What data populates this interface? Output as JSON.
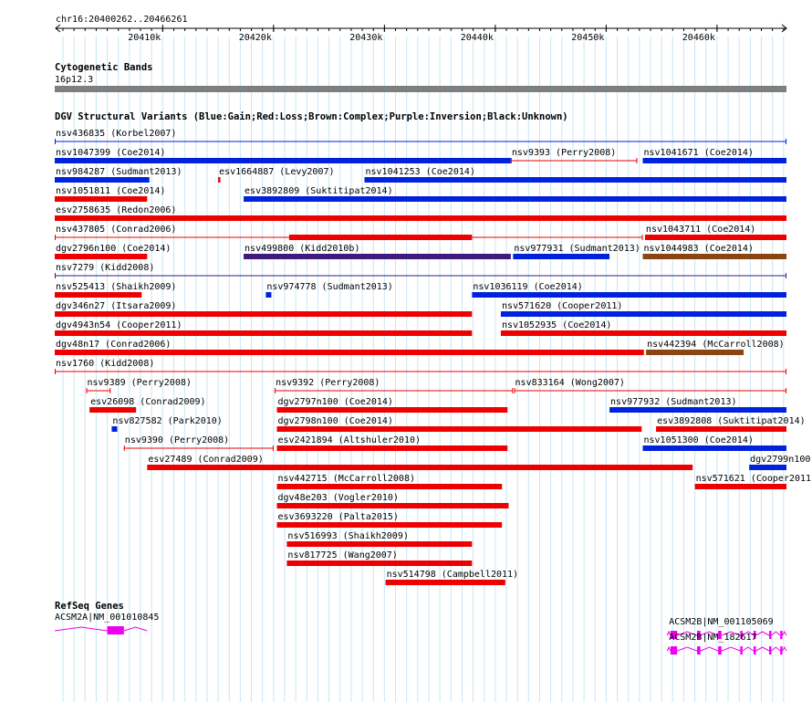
{
  "ruler": {
    "position_label": "chr16:20400262..20466261",
    "start": 20400262,
    "end": 20466261,
    "ticks": [
      {
        "pos": 20410000,
        "label": "20410k"
      },
      {
        "pos": 20420000,
        "label": "20420k"
      },
      {
        "pos": 20430000,
        "label": "20430k"
      },
      {
        "pos": 20440000,
        "label": "20440k"
      },
      {
        "pos": 20450000,
        "label": "20450k"
      },
      {
        "pos": 20460000,
        "label": "20460k"
      }
    ]
  },
  "cytoband": {
    "title": "Cytogenetic Bands",
    "band_label": "16p12.3",
    "color": "#7f7f7f"
  },
  "dgv": {
    "title": "DGV Structural Variants (Blue:Gain;Red:Loss;Brown:Complex;Purple:Inversion;Black:Unknown)",
    "colors": {
      "gain": "#0022dd",
      "loss": "#ee0000",
      "complex": "#8b4513",
      "inversion": "#3f1a7f",
      "unknown": "#000000"
    },
    "variants": [
      {
        "name": "nsv436835 (Korbel2007)",
        "start": 20400262,
        "end": 20466261,
        "type": "gain",
        "style": "line",
        "row": 0
      },
      {
        "name": "nsv1047399 (Coe2014)",
        "start": 20400262,
        "end": 20441400,
        "type": "gain",
        "style": "bar",
        "row": 1
      },
      {
        "name": "nsv9393 (Perry2008)",
        "start": 20441400,
        "end": 20452800,
        "type": "loss",
        "style": "line",
        "row": 1
      },
      {
        "name": "nsv1041671 (Coe2014)",
        "start": 20453300,
        "end": 20466261,
        "type": "gain",
        "style": "bar",
        "row": 1
      },
      {
        "name": "nsv984287 (Sudmant2013)",
        "start": 20400262,
        "end": 20408800,
        "type": "gain",
        "style": "bar",
        "row": 2
      },
      {
        "name": "esv1664887 (Levy2007)",
        "start": 20415000,
        "end": 20415200,
        "type": "loss",
        "style": "bar",
        "row": 2
      },
      {
        "name": "nsv1041253 (Coe2014)",
        "start": 20428200,
        "end": 20466261,
        "type": "gain",
        "style": "bar",
        "row": 2
      },
      {
        "name": "nsv1051811 (Coe2014)",
        "start": 20400262,
        "end": 20408600,
        "type": "loss",
        "style": "bar",
        "row": 3
      },
      {
        "name": "esv3892809 (Suktitipat2014)",
        "start": 20417300,
        "end": 20466261,
        "type": "gain",
        "style": "bar",
        "row": 3
      },
      {
        "name": "esv2758635 (Redon2006)",
        "start": 20400262,
        "end": 20466261,
        "type": "loss",
        "style": "bar",
        "row": 4
      },
      {
        "name": "nsv437805 (Conrad2006)",
        "start": 20400262,
        "end": 20453300,
        "type": "loss",
        "style": "linebar",
        "subStart": 20421400,
        "subEnd": 20437900,
        "row": 5
      },
      {
        "name": "nsv1043711 (Coe2014)",
        "start": 20453500,
        "end": 20466261,
        "type": "loss",
        "style": "bar",
        "row": 5
      },
      {
        "name": "dgv2796n100 (Coe2014)",
        "start": 20400262,
        "end": 20408600,
        "type": "loss",
        "style": "bar",
        "row": 6
      },
      {
        "name": "nsv499800 (Kidd2010b)",
        "start": 20417300,
        "end": 20441400,
        "type": "inversion",
        "style": "bar",
        "row": 6
      },
      {
        "name": "nsv977931 (Sudmant2013)",
        "start": 20441600,
        "end": 20450300,
        "type": "gain",
        "style": "bar",
        "row": 6
      },
      {
        "name": "nsv1044983 (Coe2014)",
        "start": 20453300,
        "end": 20466261,
        "type": "complex",
        "style": "bar",
        "row": 6
      },
      {
        "name": "nsv7279 (Kidd2008)",
        "start": 20400262,
        "end": 20466261,
        "type": "inversion",
        "style": "line",
        "row": 7
      },
      {
        "name": "nsv525413 (Shaikh2009)",
        "start": 20400262,
        "end": 20408100,
        "type": "loss",
        "style": "bar",
        "row": 8
      },
      {
        "name": "nsv974778 (Sudmant2013)",
        "start": 20419300,
        "end": 20419800,
        "type": "gain",
        "style": "bar",
        "row": 8
      },
      {
        "name": "nsv1036119 (Coe2014)",
        "start": 20437900,
        "end": 20466261,
        "type": "gain",
        "style": "bar",
        "row": 8
      },
      {
        "name": "dgv346n27 (Itsara2009)",
        "start": 20400262,
        "end": 20437900,
        "type": "loss",
        "style": "bar",
        "row": 9
      },
      {
        "name": "nsv571620 (Cooper2011)",
        "start": 20440500,
        "end": 20466261,
        "type": "gain",
        "style": "bar",
        "row": 9
      },
      {
        "name": "dgv4943n54 (Cooper2011)",
        "start": 20400262,
        "end": 20437900,
        "type": "loss",
        "style": "bar",
        "row": 10
      },
      {
        "name": "nsv1052935 (Coe2014)",
        "start": 20440500,
        "end": 20466261,
        "type": "loss",
        "style": "bar",
        "row": 10
      },
      {
        "name": "dgv48n17 (Conrad2006)",
        "start": 20400262,
        "end": 20453400,
        "type": "loss",
        "style": "bar",
        "row": 11
      },
      {
        "name": "nsv442394 (McCarroll2008)",
        "start": 20453600,
        "end": 20462400,
        "type": "complex",
        "style": "bar",
        "row": 11
      },
      {
        "name": "nsv1760 (Kidd2008)",
        "start": 20400262,
        "end": 20466261,
        "type": "loss",
        "style": "line",
        "row": 12
      },
      {
        "name": "nsv9389 (Perry2008)",
        "start": 20403100,
        "end": 20405300,
        "type": "loss",
        "style": "line",
        "row": 13
      },
      {
        "name": "nsv9392 (Perry2008)",
        "start": 20420100,
        "end": 20441600,
        "type": "loss",
        "style": "line",
        "row": 13
      },
      {
        "name": "nsv833164 (Wong2007)",
        "start": 20441700,
        "end": 20466261,
        "type": "loss",
        "style": "line",
        "row": 13
      },
      {
        "name": "esv26098 (Conrad2009)",
        "start": 20403400,
        "end": 20407600,
        "type": "loss",
        "style": "bar",
        "row": 14
      },
      {
        "name": "dgv2797n100 (Coe2014)",
        "start": 20420300,
        "end": 20441100,
        "type": "loss",
        "style": "bar",
        "row": 14
      },
      {
        "name": "nsv977932 (Sudmant2013)",
        "start": 20450300,
        "end": 20466261,
        "type": "gain",
        "style": "bar",
        "row": 14
      },
      {
        "name": "nsv827582 (Park2010)",
        "start": 20405400,
        "end": 20405900,
        "type": "gain",
        "style": "bar",
        "row": 15
      },
      {
        "name": "dgv2798n100 (Coe2014)",
        "start": 20420300,
        "end": 20453200,
        "type": "loss",
        "style": "bar",
        "row": 15
      },
      {
        "name": "esv3892808 (Suktitipat2014)",
        "start": 20454500,
        "end": 20466261,
        "type": "loss",
        "style": "bar",
        "row": 15
      },
      {
        "name": "nsv9390 (Perry2008)",
        "start": 20406500,
        "end": 20420000,
        "type": "loss",
        "style": "line",
        "row": 16
      },
      {
        "name": "esv2421894 (Altshuler2010)",
        "start": 20420300,
        "end": 20441100,
        "type": "loss",
        "style": "bar",
        "row": 16
      },
      {
        "name": "nsv1051300 (Coe2014)",
        "start": 20453300,
        "end": 20466261,
        "type": "gain",
        "style": "bar",
        "row": 16
      },
      {
        "name": "esv27489 (Conrad2009)",
        "start": 20408600,
        "end": 20457800,
        "type": "loss",
        "style": "bar",
        "row": 17
      },
      {
        "name": "dgv2799n100",
        "start": 20462900,
        "end": 20466261,
        "type": "gain",
        "style": "bar",
        "row": 17
      },
      {
        "name": "nsv442715 (McCarroll2008)",
        "start": 20420300,
        "end": 20440600,
        "type": "loss",
        "style": "bar",
        "row": 18
      },
      {
        "name": "nsv571621 (Cooper2011)",
        "start": 20458000,
        "end": 20466261,
        "type": "loss",
        "style": "bar",
        "row": 18
      },
      {
        "name": "dgv48e203 (Vogler2010)",
        "start": 20420300,
        "end": 20441200,
        "type": "loss",
        "style": "bar",
        "row": 19
      },
      {
        "name": "esv3693220 (Palta2015)",
        "start": 20420300,
        "end": 20440600,
        "type": "loss",
        "style": "bar",
        "row": 20
      },
      {
        "name": "nsv516993 (Shaikh2009)",
        "start": 20421200,
        "end": 20437900,
        "type": "loss",
        "style": "bar",
        "row": 21
      },
      {
        "name": "nsv817725 (Wang2007)",
        "start": 20421200,
        "end": 20437900,
        "type": "loss",
        "style": "bar",
        "row": 22
      },
      {
        "name": "nsv514798 (Campbell2011)",
        "start": 20430100,
        "end": 20440900,
        "type": "loss",
        "style": "bar",
        "row": 23
      }
    ]
  },
  "refseq": {
    "title": "RefSeq Genes",
    "color": "#ee00ee",
    "genes": [
      {
        "label": "ACSM2A|NM_001010845",
        "start": 20400262,
        "end": 20408600,
        "exons": [
          [
            20405000,
            20406500
          ]
        ],
        "row": 0
      },
      {
        "label": "ACSM2B|NM_001105069",
        "start": 20455500,
        "end": 20466261,
        "exons": [
          [
            20455800,
            20456400
          ],
          [
            20458200,
            20458500
          ],
          [
            20460100,
            20460400
          ],
          [
            20462100,
            20462300
          ],
          [
            20463300,
            20463500
          ],
          [
            20464700,
            20464900
          ],
          [
            20465700,
            20465900
          ]
        ],
        "row": 1
      },
      {
        "label": "ACSM2B|NM_182617",
        "start": 20455500,
        "end": 20466261,
        "exons": [
          [
            20455800,
            20456400
          ],
          [
            20458200,
            20458500
          ],
          [
            20460100,
            20460400
          ],
          [
            20462100,
            20462300
          ],
          [
            20463300,
            20463500
          ],
          [
            20464700,
            20464900
          ],
          [
            20465700,
            20465900
          ]
        ],
        "row": 2
      }
    ]
  }
}
